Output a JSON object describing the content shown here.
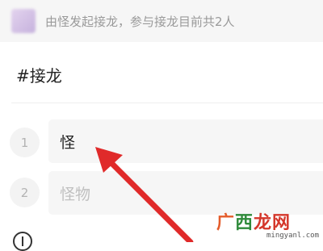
{
  "header": {
    "text": "由怪发起接龙，参与接龙目前共2人"
  },
  "topic": {
    "hashtag": "#接龙"
  },
  "entries": [
    {
      "number": "1",
      "text": "怪",
      "filled": true
    },
    {
      "number": "2",
      "text": "怪物",
      "filled": false
    }
  ],
  "annotation": {
    "arrow_color": "#e02a2a"
  },
  "watermark": {
    "part_a": "广",
    "part_b": "西",
    "part_c": "龙网",
    "url": "mingyanl.com"
  }
}
